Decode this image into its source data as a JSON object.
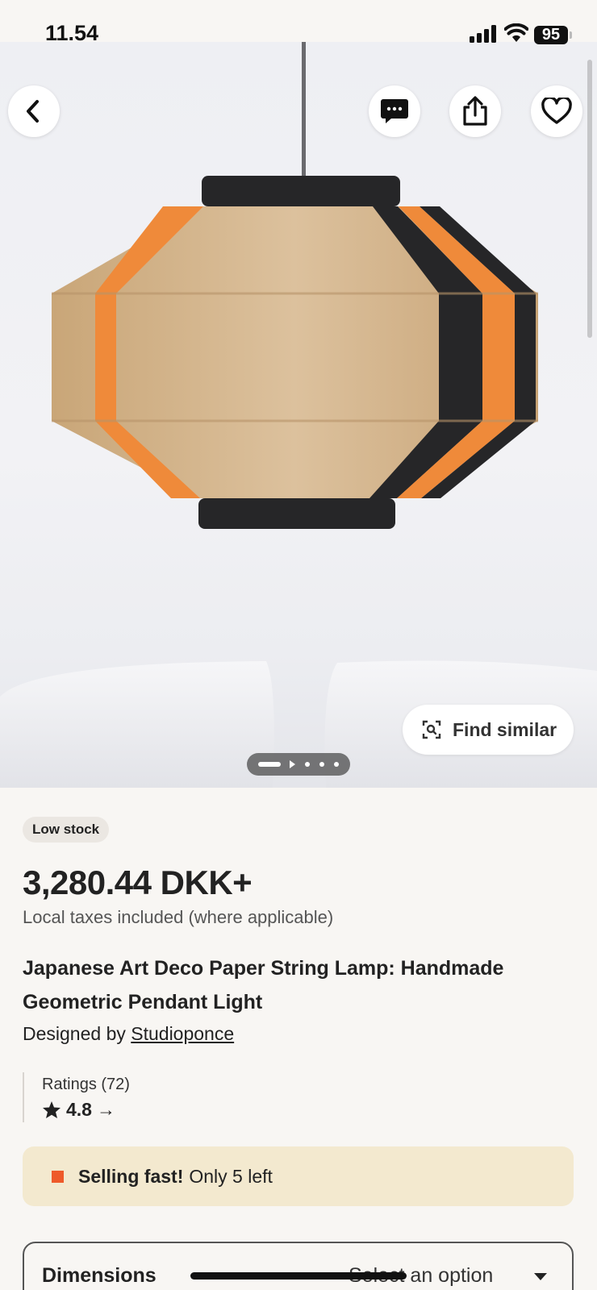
{
  "status_bar": {
    "time": "11.54",
    "battery": "95"
  },
  "hero": {
    "buttons": {
      "back": "back",
      "message": "message",
      "share": "share",
      "favorite": "favorite"
    },
    "find_similar_label": "Find similar",
    "pager": {
      "total": 5,
      "active_index": 0
    }
  },
  "product": {
    "stock_badge": "Low stock",
    "price": "3,280.44 DKK+",
    "tax_note": "Local taxes included (where applicable)",
    "title": "Japanese Art Deco Paper String Lamp: Handmade Geometric Pendant Light",
    "designed_by_prefix": "Designed by",
    "designer_name": "Studioponce",
    "ratings_label": "Ratings (72)",
    "rating_value": "4.8",
    "rating_arrow": "→",
    "selling_fast_strong": "Selling fast!",
    "selling_fast_rest": "Only 5 left",
    "dimensions_label": "Dimensions",
    "dimensions_value": "Select an option"
  },
  "colors": {
    "background": "#f8f6f3",
    "alert_bg": "#f3e9cf",
    "alert_square": "#ee5a2a",
    "badge_bg": "#ebe7e2",
    "lamp_jute": "#d4b48e",
    "lamp_orange": "#ef8a3a",
    "lamp_black": "#262628"
  },
  "icons": {
    "back": "chevron-left-icon",
    "message": "message-icon",
    "share": "share-icon",
    "favorite": "heart-icon",
    "find_similar": "visual-search-icon",
    "rating_star": "star-icon",
    "dropdown": "caret-down-icon"
  }
}
